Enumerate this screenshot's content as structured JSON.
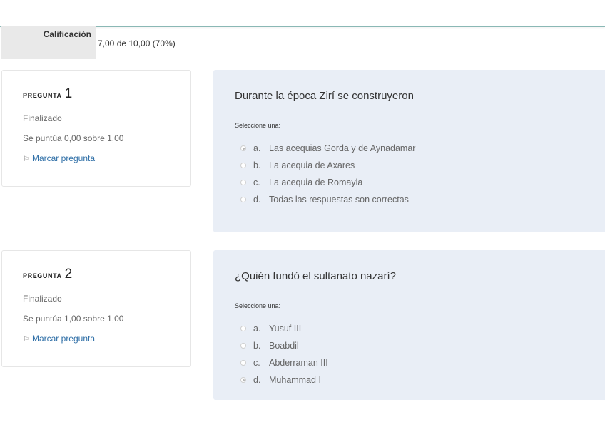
{
  "summary": {
    "grade_label": "Calificación",
    "grade_value": "7,00 de 10,00 (70%)"
  },
  "questions": [
    {
      "title": "Pregunta",
      "number": "1",
      "state": "Finalizado",
      "grade": "Se puntúa 0,00 sobre 1,00",
      "flag_label": "Marcar pregunta",
      "question": "Durante la época Zirí se construyeron",
      "prompt": "Seleccione una:",
      "answers": [
        {
          "letter": "a.",
          "text": "Las acequias Gorda y de Aynadamar",
          "selected": true
        },
        {
          "letter": "b.",
          "text": "La acequia de Axares",
          "selected": false
        },
        {
          "letter": "c.",
          "text": "La acequia de Romayla",
          "selected": false
        },
        {
          "letter": "d.",
          "text": "Todas las respuestas son correctas",
          "selected": false
        }
      ]
    },
    {
      "title": "Pregunta",
      "number": "2",
      "state": "Finalizado",
      "grade": "Se puntúa 1,00 sobre 1,00",
      "flag_label": "Marcar pregunta",
      "question": "¿Quién fundó el sultanato nazarí?",
      "prompt": "Seleccione una:",
      "answers": [
        {
          "letter": "a.",
          "text": "Yusuf III",
          "selected": false
        },
        {
          "letter": "b.",
          "text": "Boabdil",
          "selected": false
        },
        {
          "letter": "c.",
          "text": "Abderraman III",
          "selected": false
        },
        {
          "letter": "d.",
          "text": "Muhammad I",
          "selected": true
        }
      ]
    }
  ],
  "icons": {
    "flag": "flag-icon",
    "radio": "radio-icon"
  },
  "colors": {
    "link": "#2f6fa7",
    "content_bg": "#e9eef6",
    "grade_label_bg": "#e9e9e9"
  }
}
